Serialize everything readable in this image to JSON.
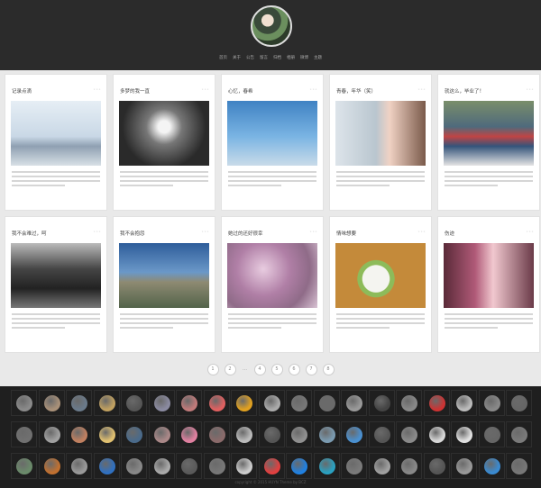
{
  "header": {
    "nav": [
      "首页",
      "关于",
      "公告",
      "留言",
      "归档",
      "相册",
      "微博",
      "主题"
    ]
  },
  "cards": [
    {
      "title": "记录点滴",
      "img": "linear-gradient(#e6eef5,#c9d8e6 55%,#8fa0b2 70%,#d8e0e6)"
    },
    {
      "title": "多梦的我一直",
      "img": "radial-gradient(circle at 50% 40%,#f4f4f4 0 10%,#777 30%,#2a2a2a 70%)"
    },
    {
      "title": "心忆，春希",
      "img": "linear-gradient(#3f82c3,#7ab4e3 55%,#c9dbe9)"
    },
    {
      "title": "青春，年华（笑）",
      "img": "linear-gradient(90deg,#dde4ea,#b9c6cf 45%,#f0d2c4 60%,#7a5a4a)"
    },
    {
      "title": "就这么，毕业了！",
      "img": "linear-gradient(#7a8e6a,#4f6a7c 40%,#c04444 55%,#34547a 70%,#e4e4e4)"
    },
    {
      "title": "我不会难过，呵",
      "img": "linear-gradient(#bbbbbb,#454545 40%,#222 70%,#777)"
    },
    {
      "title": "我不会抱怨",
      "img": "linear-gradient(#2e5d9a,#6b98c8 45%,#8e8a72 60%,#52634a)"
    },
    {
      "title": "她过的还好很幸",
      "img": "radial-gradient(circle at 40% 40%,#e8cce0,#b07fa6 40%,#8f6b88 70%,#d9c3d4)"
    },
    {
      "title": "情味想要",
      "img": "radial-gradient(circle at 45% 55%,#f4f4f0 0 22%,#8dbb5a 23% 30%,#c48a3a 31% 100%)"
    },
    {
      "title": "伤迹",
      "img": "linear-gradient(90deg,#5a2a38,#b05a78 35%,#f1c8cf 55%,#6a3a48)"
    }
  ],
  "pager": [
    "1",
    "2",
    "…",
    "4",
    "5",
    "6",
    "7",
    "8"
  ],
  "footer": {
    "icon_colors": [
      "#8a8a8a",
      "#a89078",
      "#6a7a8a",
      "#c0a060",
      "#555",
      "#8a8aa0",
      "#c07a7a",
      "#e06060",
      "#e0a020",
      "#aaa",
      "#777",
      "#6a6a6a",
      "#999",
      "#444",
      "#888",
      "#cc3333",
      "#bbb",
      "#888",
      "#666",
      "#707070",
      "#a0a0a0",
      "#c08060",
      "#e0c070",
      "#4a6a8a",
      "#aa8888",
      "#e080a0",
      "#8a6a6a",
      "#bbbbbb",
      "#555",
      "#909090",
      "#7a9ab0",
      "#4a90d0",
      "#555",
      "#8a8a8a",
      "#d8d8d8",
      "#e0e0e0",
      "#666",
      "#7a7a7a",
      "#6a8a6a",
      "#c07030",
      "#999",
      "#3070c0",
      "#888",
      "#aaaaaa",
      "#5a5a5a",
      "#777",
      "#ccc",
      "#e04040",
      "#2080e0",
      "#2aa0c0",
      "#7a7a7a",
      "#a0a0a0",
      "#888",
      "#555",
      "#999",
      "#3a8ad0",
      "#777"
    ],
    "copyright": "copyright © 2015 HUYN Theme by BCZ"
  }
}
